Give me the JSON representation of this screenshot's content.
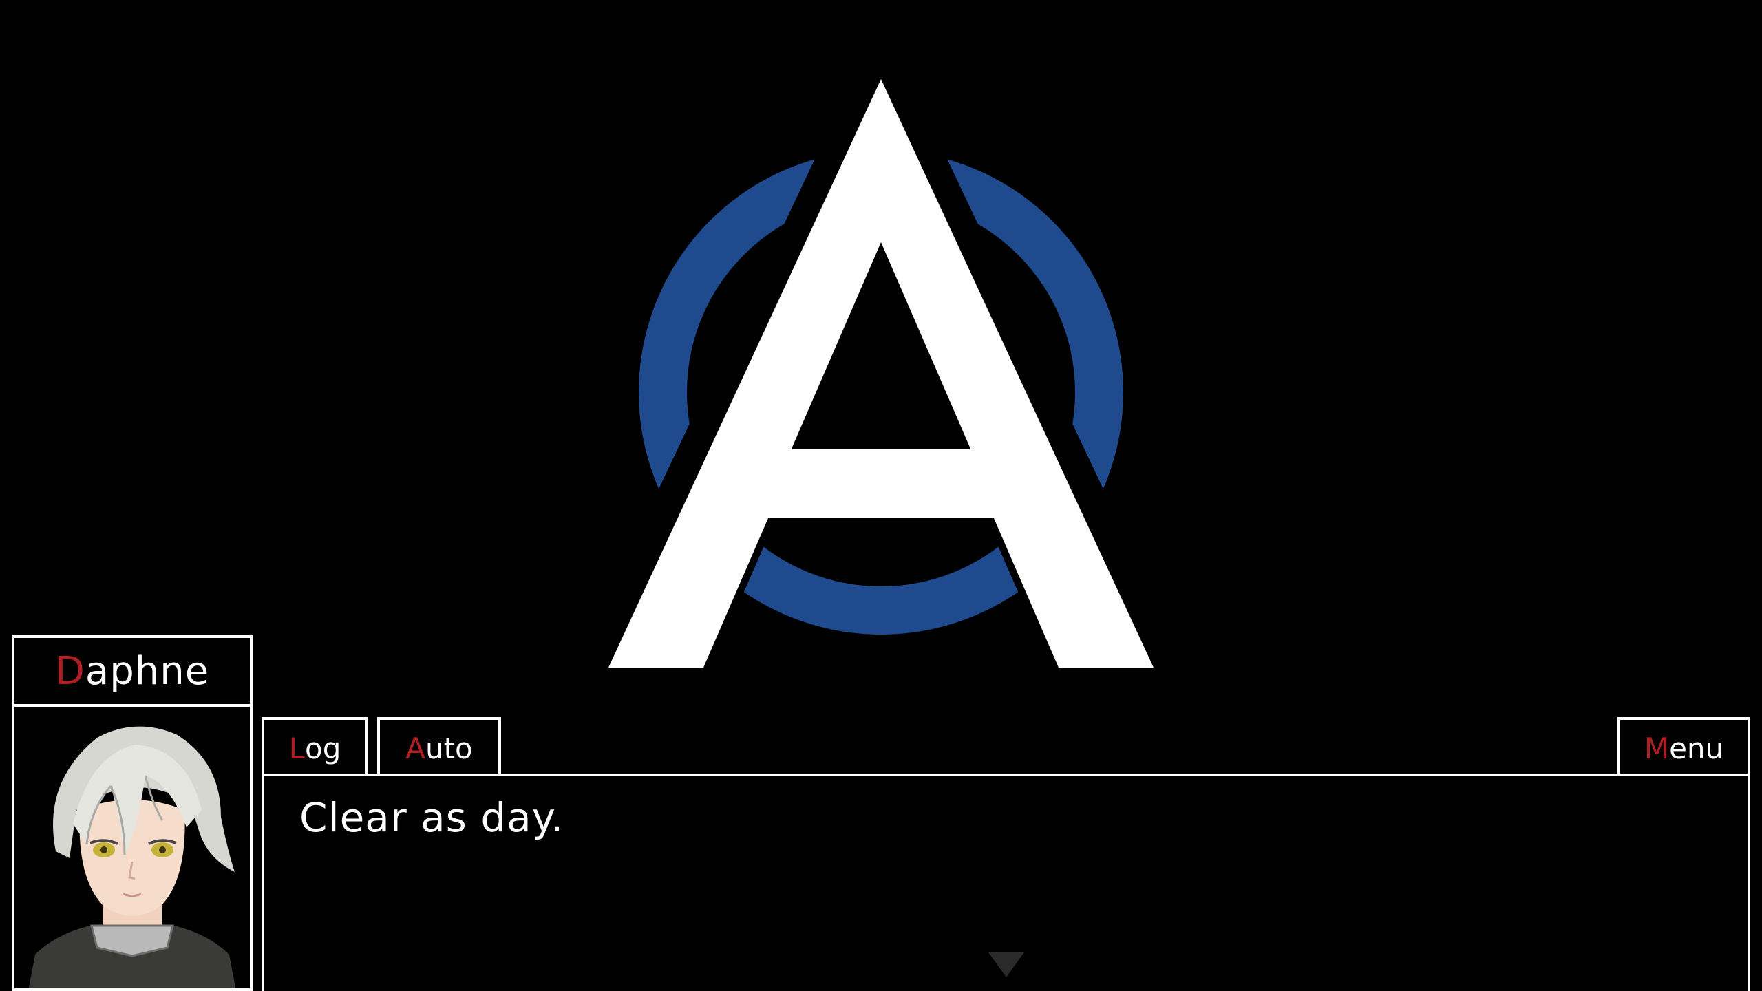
{
  "logo": {
    "letter": "A",
    "ring_color": "#1f4b8e",
    "letter_color": "#ffffff"
  },
  "speaker": {
    "initial": "D",
    "rest": "aphne"
  },
  "buttons": {
    "log": {
      "initial": "L",
      "rest": "og"
    },
    "auto": {
      "initial": "A",
      "rest": "uto"
    },
    "menu": {
      "initial": "M",
      "rest": "enu"
    }
  },
  "dialogue": {
    "text": "Clear as day."
  },
  "colors": {
    "accent": "#b01e23",
    "border": "#ffffff",
    "background": "#000000"
  }
}
